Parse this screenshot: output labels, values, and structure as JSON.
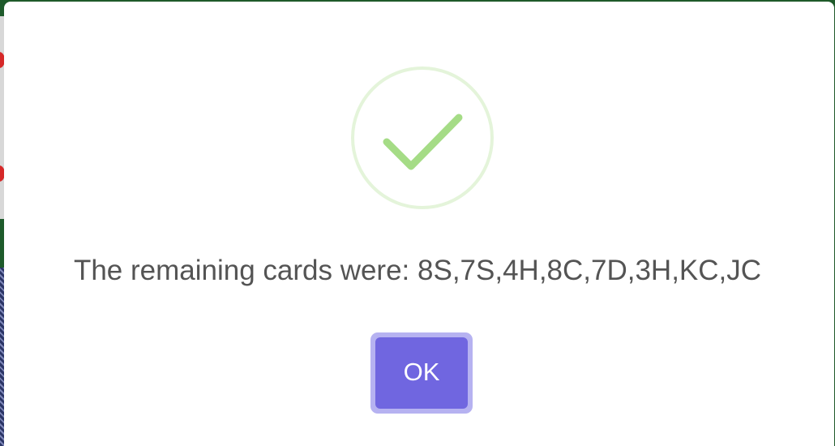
{
  "dialog": {
    "icon": "success-check-icon",
    "message": "The remaining cards were: 8S,7S,4H,8C,7D,3H,KC,JC",
    "ok_label": "OK"
  },
  "colors": {
    "accent": "#7066e0",
    "success": "#a5dc86",
    "text": "#545454"
  }
}
